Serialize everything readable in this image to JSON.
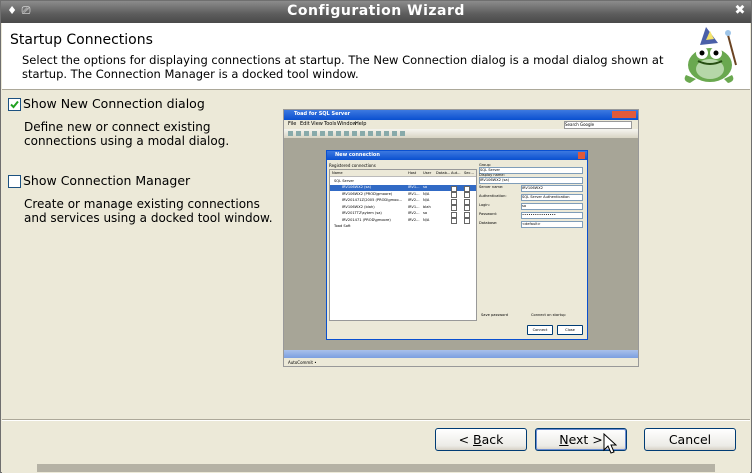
{
  "window": {
    "title": "Configuration Wizard"
  },
  "header": {
    "title": "Startup Connections",
    "description": "Select the options for displaying connections at startup.  The New Connection dialog is a modal dialog shown at startup.  The Connection Manager is a docked tool window."
  },
  "options": [
    {
      "label": "Show New Connection dialog",
      "checked": true,
      "description": "Define new or connect existing connections using a modal dialog."
    },
    {
      "label": "Show Connection Manager",
      "checked": false,
      "description": "Create or manage existing connections and services using a docked tool window."
    }
  ],
  "preview": {
    "app_title": "Toad for SQL Server",
    "menu": [
      "File",
      "Edit",
      "View",
      "Tools",
      "Window",
      "Help"
    ],
    "search_placeholder": "Search Google",
    "dialog_title": "New connection",
    "registered_label": "Registered connections",
    "columns": [
      "Name",
      "Host",
      "User",
      "Datab...",
      "Aut...",
      "Sec..."
    ],
    "tree": [
      {
        "name": "SQL Server",
        "host": "",
        "user": "",
        "db": ""
      },
      {
        "name": "IRV106WX2 (sa)",
        "host": "IRV1...",
        "user": "sa",
        "db": ""
      },
      {
        "name": "IRV106WX2 (PROD\\gmoore)",
        "host": "IRV1...",
        "user": "N/A",
        "db": ""
      },
      {
        "name": "IRV201471Z\\2005 (PROD\\gmoo...",
        "host": "IRV2...",
        "user": "N/A",
        "db": ""
      },
      {
        "name": "IRV106WX2 (blah)",
        "host": "IRV1...",
        "user": "blah",
        "db": ""
      },
      {
        "name": "IRV201TTZ\\sytem (sa)",
        "host": "IRV2...",
        "user": "sa",
        "db": ""
      },
      {
        "name": "IRV201471 (PROD\\gmoore)",
        "host": "IRV2...",
        "user": "N/A",
        "db": ""
      },
      {
        "name": "Toad Soft",
        "host": "",
        "user": "",
        "db": ""
      }
    ],
    "fields": [
      {
        "label": "Group:",
        "value": "SQL Server"
      },
      {
        "label": "Display name:",
        "value": "IRV106WX2 (sa)"
      },
      {
        "label": "Server name:",
        "value": "IRV106WX2"
      },
      {
        "label": "Authentication:",
        "value": "SQL Server Authentication"
      },
      {
        "label": "Login:",
        "value": "sa"
      },
      {
        "label": "Password:",
        "value": "••••••••••••••••"
      },
      {
        "label": "Database:",
        "value": "<default>"
      }
    ],
    "save_password": "Save password",
    "connect_on_startup": "Connect on startup",
    "connect_btn": "Connect",
    "close_btn": "Close",
    "status": "AutoCommit •"
  },
  "buttons": {
    "back": {
      "prefix": "< ",
      "mnemonic": "B",
      "rest": "ack"
    },
    "next": {
      "prefix": "",
      "mnemonic": "N",
      "rest": "ext >"
    },
    "cancel": "Cancel"
  },
  "colors": {
    "accent": "#0a246a",
    "header_bg": "#ffffff",
    "dialog_bg": "#ece9d8"
  }
}
